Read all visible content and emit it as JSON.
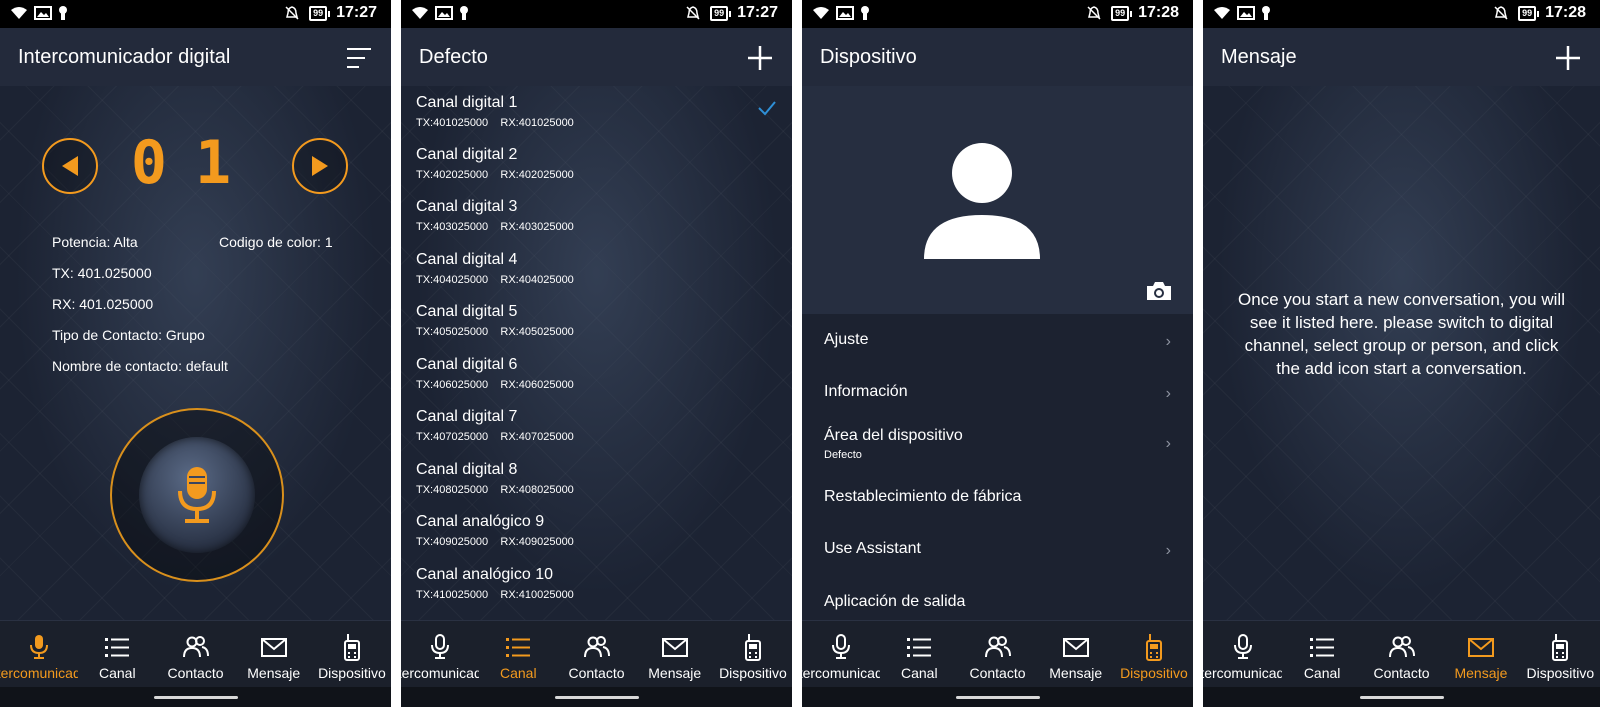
{
  "status": {
    "screens": [
      {
        "time": "17:27",
        "battery": "99"
      },
      {
        "time": "17:27",
        "battery": "99"
      },
      {
        "time": "17:28",
        "battery": "99"
      },
      {
        "time": "17:28",
        "battery": "99"
      }
    ]
  },
  "tabs": [
    {
      "label": "Intercomunicador",
      "icon": "microphone-icon"
    },
    {
      "label": "Canal",
      "icon": "list-icon"
    },
    {
      "label": "Contacto",
      "icon": "contacts-icon"
    },
    {
      "label": "Mensaje",
      "icon": "envelope-icon"
    },
    {
      "label": "Dispositivo",
      "icon": "radio-device-icon"
    }
  ],
  "accent_color": "#f39a1e",
  "intercom": {
    "title": "Intercomunicador digital",
    "channel_number": "01",
    "power": "Potencia: Alta",
    "color_code": "Codigo de color: 1",
    "tx": "TX: 401.025000",
    "rx": "RX: 401.025000",
    "contact_type": "Tipo de Contacto: Grupo",
    "contact_name": "Nombre de contacto: default"
  },
  "channels": {
    "title": "Defecto",
    "items": [
      {
        "name": "Canal digital 1",
        "tx": "TX:401025000",
        "rx": "RX:401025000",
        "selected": true
      },
      {
        "name": "Canal digital 2",
        "tx": "TX:402025000",
        "rx": "RX:402025000"
      },
      {
        "name": "Canal digital 3",
        "tx": "TX:403025000",
        "rx": "RX:403025000"
      },
      {
        "name": "Canal digital 4",
        "tx": "TX:404025000",
        "rx": "RX:404025000"
      },
      {
        "name": "Canal digital 5",
        "tx": "TX:405025000",
        "rx": "RX:405025000"
      },
      {
        "name": "Canal digital 6",
        "tx": "TX:406025000",
        "rx": "RX:406025000"
      },
      {
        "name": "Canal digital 7",
        "tx": "TX:407025000",
        "rx": "RX:407025000"
      },
      {
        "name": "Canal digital 8",
        "tx": "TX:408025000",
        "rx": "RX:408025000"
      },
      {
        "name": "Canal analógico 9",
        "tx": "TX:409025000",
        "rx": "RX:409025000"
      },
      {
        "name": "Canal analógico 10",
        "tx": "TX:410025000",
        "rx": "RX:410025000"
      }
    ]
  },
  "device": {
    "title": "Dispositivo",
    "menu": [
      {
        "label": "Ajuste",
        "chevron": true
      },
      {
        "label": "Información",
        "chevron": true
      },
      {
        "label": "Área del dispositivo",
        "sub": "Defecto",
        "chevron": true
      },
      {
        "label": "Restablecimiento de fábrica",
        "chevron": false
      },
      {
        "label": "Use Assistant",
        "chevron": true
      },
      {
        "label": "Aplicación de salida",
        "chevron": false
      }
    ]
  },
  "message": {
    "title": "Mensaje",
    "empty_text": "Once you start a new conversation, you will see it listed here. please switch to digital channel, select group or person, and click the add icon start a conversation."
  }
}
